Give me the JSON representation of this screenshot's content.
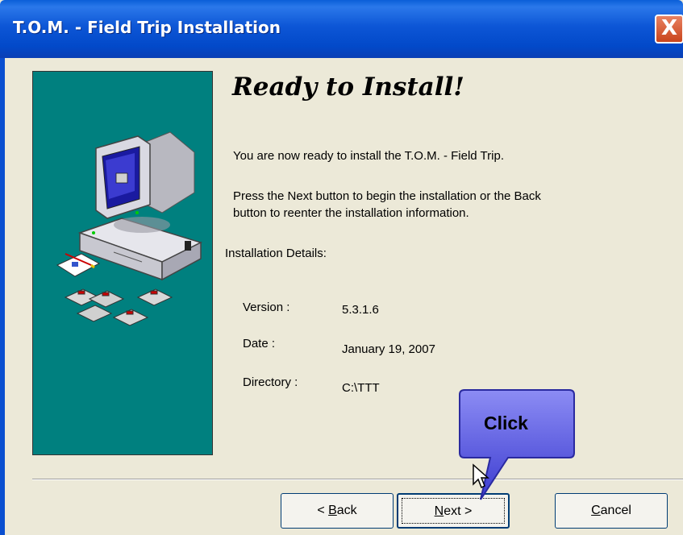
{
  "window": {
    "title": "T.O.M. - Field Trip Installation",
    "close_label": "X"
  },
  "main": {
    "heading": "Ready to Install!",
    "intro": "You are now ready to install the T.O.M. - Field Trip.",
    "instructions_line1": "Press the Next button to begin the installation or the Back",
    "instructions_line2": "button to reenter the installation information.",
    "details_label": "Installation Details:",
    "details": [
      {
        "label": "Version :",
        "value": "5.3.1.6"
      },
      {
        "label": "Date :",
        "value": "January 19, 2007"
      },
      {
        "label": "Directory :",
        "value": "C:\\TTT"
      }
    ]
  },
  "buttons": {
    "back_mnemonic": "B",
    "back_rest": "ack",
    "back_prefix": "< ",
    "next_mnemonic": "N",
    "next_rest": "ext >",
    "cancel_mnemonic": "C",
    "cancel_rest": "ancel"
  },
  "callout": {
    "text": "Click"
  },
  "colors": {
    "titlebar": "#0a4fd0",
    "side_panel": "#00807f",
    "dialog_bg": "#ece9d8",
    "callout": "#4a4ad8"
  }
}
